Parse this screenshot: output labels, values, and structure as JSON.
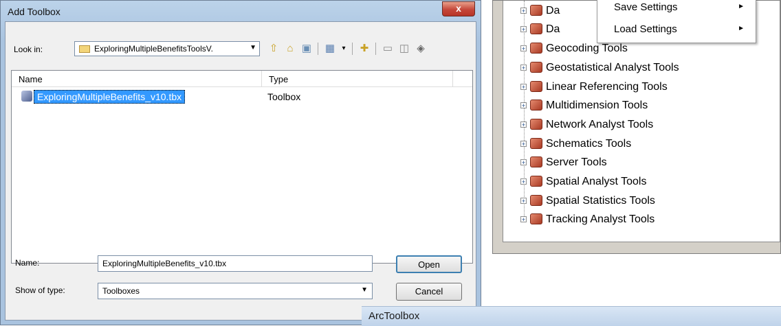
{
  "dialog": {
    "title": "Add Toolbox",
    "close_label": "x",
    "look_in_label": "Look in:",
    "look_in_value": "ExploringMultipleBenefitsToolsV.",
    "columns": [
      "Name",
      "Type"
    ],
    "files": [
      {
        "name": "ExploringMultipleBenefits_v10.tbx",
        "type": "Toolbox"
      }
    ],
    "name_label": "Name:",
    "name_value": "ExploringMultipleBenefits_v10.tbx",
    "type_label": "Show of type:",
    "type_value": "Toolboxes",
    "open_label": "Open",
    "cancel_label": "Cancel"
  },
  "context_menu": {
    "items": [
      {
        "label": "Save Settings"
      },
      {
        "label": "Load Settings"
      }
    ]
  },
  "tree": {
    "items": [
      {
        "label": "Da"
      },
      {
        "label": "Da"
      },
      {
        "label": "Geocoding Tools"
      },
      {
        "label": "Geostatistical Analyst Tools"
      },
      {
        "label": "Linear Referencing Tools"
      },
      {
        "label": "Multidimension Tools"
      },
      {
        "label": "Network Analyst Tools"
      },
      {
        "label": "Schematics Tools"
      },
      {
        "label": "Server Tools"
      },
      {
        "label": "Spatial Analyst Tools"
      },
      {
        "label": "Spatial Statistics Tools"
      },
      {
        "label": "Tracking Analyst Tools"
      }
    ]
  },
  "arctoolbox": {
    "title": "ArcToolbox"
  },
  "colors": {
    "selection": "#3399ff",
    "close_button": "#c5473a",
    "tool_icon": "#b0412a"
  }
}
